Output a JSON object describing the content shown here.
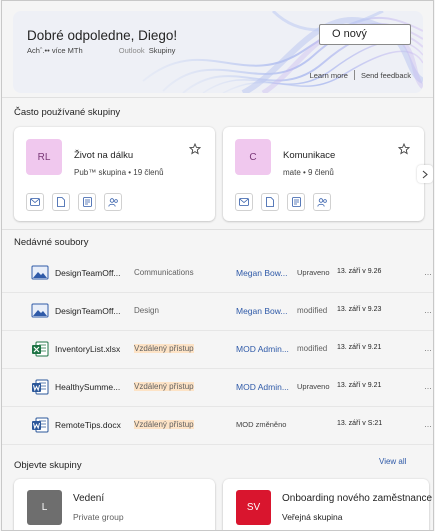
{
  "hero": {
    "greeting": "Dobré odpoledne, Diego!",
    "sub_left": "Achˆ.•• více MTh",
    "sub_app": "Outlook",
    "sub_tag": "Skupiny",
    "new_button": "O nový",
    "learn_more": "Learn more",
    "send_feedback": "Send feedback"
  },
  "frequent": {
    "title": "Často používané skupiny",
    "cards": [
      {
        "initials": "RL",
        "name": "Život na dálku",
        "meta": "Pub™ skupina • 19 členů"
      },
      {
        "initials": "C",
        "name": "Komunikace",
        "meta": "mate • 9 členů"
      }
    ]
  },
  "recent": {
    "title": "Nedávné soubory",
    "files": [
      {
        "icon": "image-file-icon",
        "name": "DesignTeamOff...",
        "location": "Communications",
        "person": "Megan Bow...",
        "activity": "Upraveno",
        "date": "13. září v 9.26"
      },
      {
        "icon": "image-file-icon",
        "name": "DesignTeamOff...",
        "location": "Design",
        "person": "Megan Bow...",
        "activity": "modified",
        "date": "13. září v 9.23"
      },
      {
        "icon": "excel-file-icon",
        "name": "InventoryList.xlsx",
        "location": "Vzdálený přístup",
        "person": "MOD Admin...",
        "activity": "modified",
        "date": "13. září v 9.21"
      },
      {
        "icon": "word-file-icon",
        "name": "HealthySumme...",
        "location": "Vzdálený přístup",
        "person": "MOD Admin...",
        "activity": "Upraveno",
        "date": "13. září v 9.21"
      },
      {
        "icon": "word-file-icon",
        "name": "RemoteTips.docx",
        "location": "Vzdálený přístup",
        "person": "",
        "activity": "MOD změněno",
        "date": "13. září v S:21"
      }
    ]
  },
  "discover": {
    "title": "Objevte skupiny",
    "view_all": "View all",
    "cards": [
      {
        "initials": "L",
        "name": "Vedení",
        "meta": "Private group",
        "color": "#6e6e6e"
      },
      {
        "initials": "SV",
        "name": "Onboarding nového zaměstnance",
        "meta": "Veřejná skupina",
        "color": "#d9152e"
      }
    ]
  },
  "colors": {
    "accent": "#2f5aa8",
    "avatar_pink": "#f0c8ee"
  }
}
